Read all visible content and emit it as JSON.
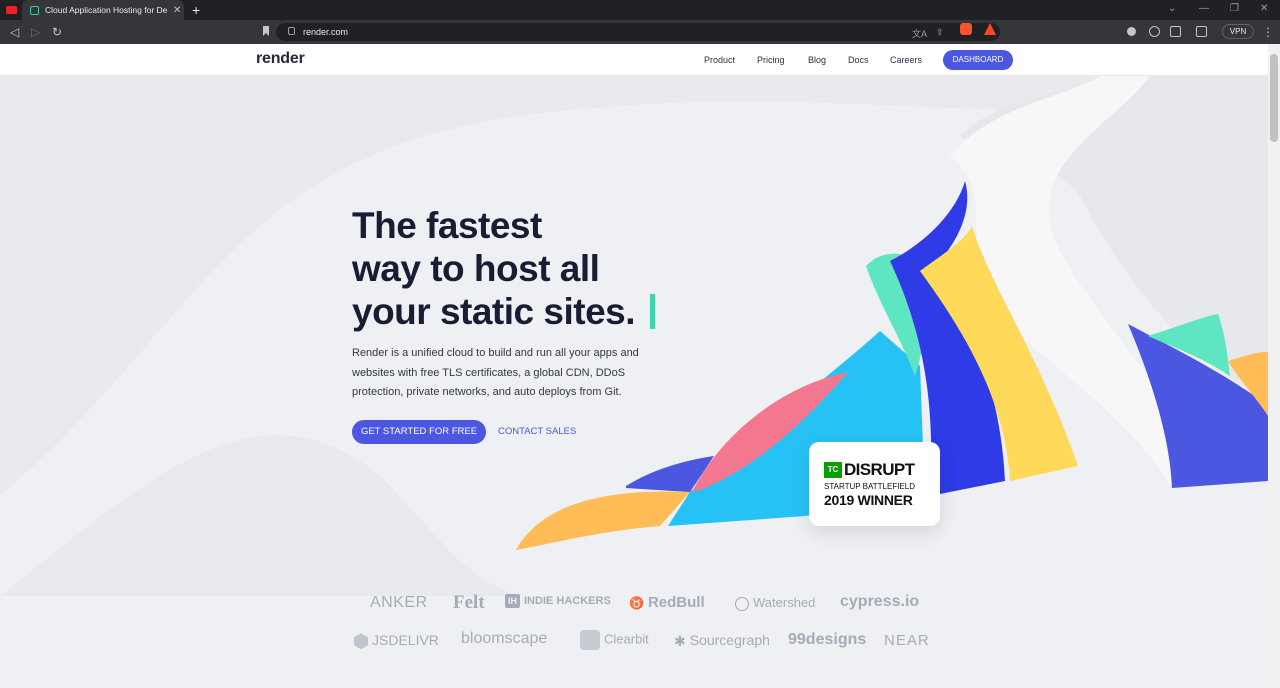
{
  "browser": {
    "tab_title": "Cloud Application Hosting for De",
    "tab_close": "✕",
    "new_tab": "+",
    "url": "render.com",
    "vpn_label": "VPN"
  },
  "header": {
    "logo": "render",
    "nav": [
      "Product",
      "Pricing",
      "Blog",
      "Docs",
      "Careers"
    ],
    "dashboard_label": "DASHBOARD"
  },
  "hero": {
    "title_lines": [
      "The fastest",
      "way to host all",
      "your static sites."
    ],
    "subtitle": "Render is a unified cloud to build and run all your apps and websites with free TLS certificates, a global CDN, DDoS protection, private networks, and auto deploys from Git.",
    "cta_label": "GET STARTED FOR FREE",
    "sales_label": "CONTACT SALES"
  },
  "badge": {
    "tc": "TC",
    "disrupt": "DISRUPT",
    "line2": "STARTUP BATTLEFIELD",
    "line3": "2019 WINNER"
  },
  "customers": {
    "row1": [
      "ANKER",
      "Felt",
      "INDIE HACKERS",
      "RedBull",
      "Watershed",
      "cypress.io"
    ],
    "row2": [
      "JSDELIVR",
      "bloomscape",
      "Clearbit",
      "Sourcegraph",
      "99designs",
      "NEAR"
    ],
    "ih_mark": "IH"
  },
  "colors": {
    "accent": "#4b57e0",
    "teal": "#3ed6b0",
    "blue": "#2e3be6",
    "cyan": "#27c2f5",
    "pink": "#f3788f",
    "yellow": "#ffd95a",
    "orange": "#ffbc57",
    "mint": "#5ee6c3"
  }
}
